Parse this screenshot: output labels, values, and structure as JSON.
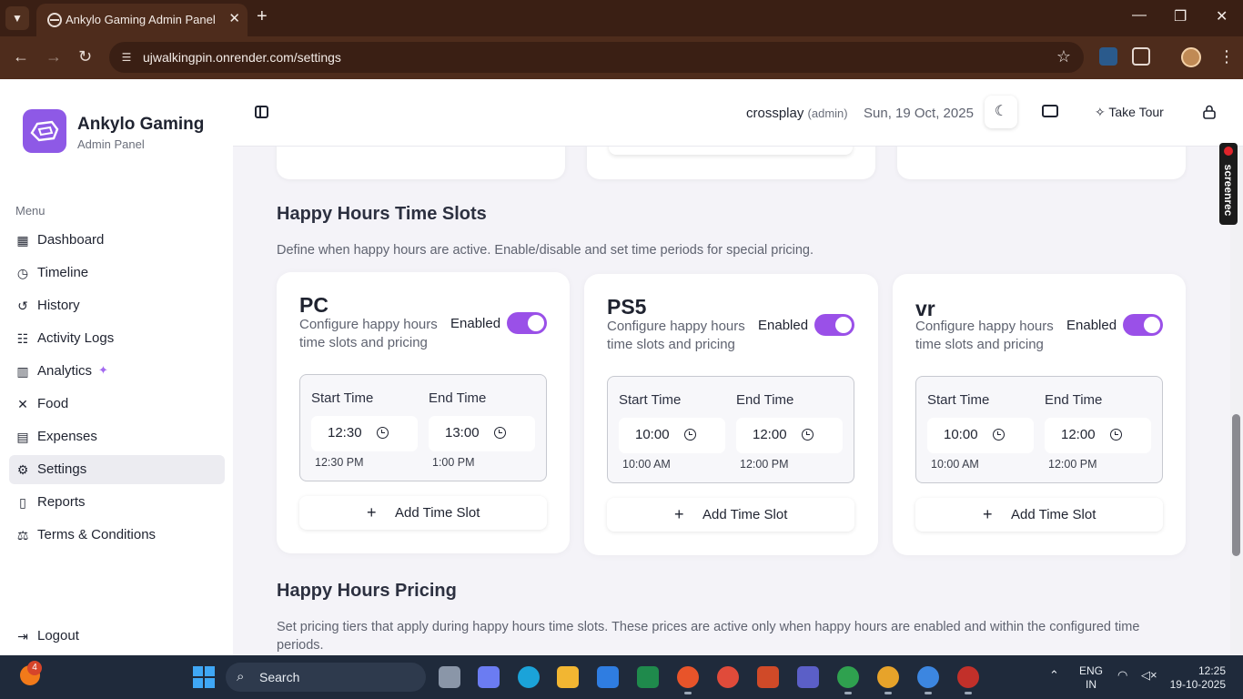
{
  "browser": {
    "tab_title": "Ankylo Gaming Admin Panel",
    "url": "ujwalkingpin.onrender.com/settings"
  },
  "sidebar": {
    "brand": "Ankylo Gaming",
    "brand_sub": "Admin Panel",
    "menu_heading": "Menu",
    "items": [
      {
        "label": "Dashboard",
        "icon": "grid-icon",
        "active": false
      },
      {
        "label": "Timeline",
        "icon": "clock-icon",
        "active": false
      },
      {
        "label": "History",
        "icon": "history-icon",
        "active": false
      },
      {
        "label": "Activity Logs",
        "icon": "list-icon",
        "active": false
      },
      {
        "label": "Analytics",
        "icon": "bar-chart-icon",
        "active": false
      },
      {
        "label": "Food",
        "icon": "utensils-icon",
        "active": false
      },
      {
        "label": "Expenses",
        "icon": "receipt-icon",
        "active": false
      },
      {
        "label": "Settings",
        "icon": "gear-icon",
        "active": true
      },
      {
        "label": "Reports",
        "icon": "file-icon",
        "active": false
      },
      {
        "label": "Terms & Conditions",
        "icon": "scale-icon",
        "active": false
      }
    ],
    "logout": "Logout"
  },
  "header": {
    "user": "crossplay",
    "role": "(admin)",
    "date": "Sun, 19 Oct, 2025",
    "tour": "Take Tour"
  },
  "happy_hours": {
    "title": "Happy Hours Time Slots",
    "description": "Define when happy hours are active. Enable/disable and set time periods for special pricing.",
    "cards": [
      {
        "platform": "PC",
        "configure": "Configure happy hours time slots and pricing",
        "enabled_label": "Enabled",
        "start_label": "Start Time",
        "end_label": "End Time",
        "start_value": "12:30",
        "end_value": "13:00",
        "start_display": "12:30 PM",
        "end_display": "1:00 PM",
        "add_label": "Add Time Slot"
      },
      {
        "platform": "PS5",
        "configure": "Configure happy hours time slots and pricing",
        "enabled_label": "Enabled",
        "start_label": "Start Time",
        "end_label": "End Time",
        "start_value": "10:00",
        "end_value": "12:00",
        "start_display": "10:00 AM",
        "end_display": "12:00 PM",
        "add_label": "Add Time Slot"
      },
      {
        "platform": "vr",
        "configure": "Configure happy hours time slots and pricing",
        "enabled_label": "Enabled",
        "start_label": "Start Time",
        "end_label": "End Time",
        "start_value": "10:00",
        "end_value": "12:00",
        "start_display": "10:00 AM",
        "end_display": "12:00 PM",
        "add_label": "Add Time Slot"
      }
    ]
  },
  "pricing": {
    "title": "Happy Hours Pricing",
    "description": "Set pricing tiers that apply during happy hours time slots. These prices are active only when happy hours are enabled and within the configured time periods."
  },
  "screenrec": "screenrec",
  "taskbar": {
    "weather_badge": "4",
    "search": "Search",
    "lang_top": "ENG",
    "lang_bottom": "IN",
    "time": "12:25",
    "date": "19-10-2025"
  },
  "colors": {
    "accent": "#9a50e8",
    "brand": "#8e59e6",
    "chrome": "#4e2c1c"
  }
}
